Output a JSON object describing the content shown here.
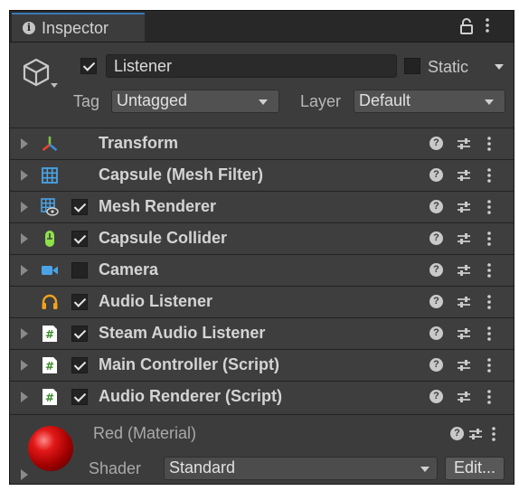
{
  "window": {
    "tab_title": "Inspector",
    "tab_icon": "info-icon"
  },
  "header": {
    "active": true,
    "name": "Listener",
    "static_label": "Static",
    "static_checked": false,
    "tag_label": "Tag",
    "tag_value": "Untagged",
    "layer_label": "Layer",
    "layer_value": "Default"
  },
  "components": [
    {
      "label": "Transform",
      "icon": "transform-icon",
      "has_checkbox": false
    },
    {
      "label": "Capsule (Mesh Filter)",
      "icon": "mesh-filter-icon",
      "has_checkbox": false
    },
    {
      "label": "Mesh Renderer",
      "icon": "mesh-renderer-icon",
      "has_checkbox": true,
      "checked": true
    },
    {
      "label": "Capsule Collider",
      "icon": "capsule-collider-icon",
      "has_checkbox": true,
      "checked": true
    },
    {
      "label": "Camera",
      "icon": "camera-icon",
      "has_checkbox": true,
      "checked": false
    },
    {
      "label": "Audio Listener",
      "icon": "audio-listener-icon",
      "has_checkbox": true,
      "checked": true
    },
    {
      "label": "Steam Audio Listener",
      "icon": "script-icon",
      "has_checkbox": true,
      "checked": true
    },
    {
      "label": "Main Controller (Script)",
      "icon": "script-icon",
      "has_checkbox": true,
      "checked": true
    },
    {
      "label": "Audio Renderer (Script)",
      "icon": "script-icon",
      "has_checkbox": true,
      "checked": true
    }
  ],
  "material": {
    "name": "Red (Material)",
    "shader_label": "Shader",
    "shader_value": "Standard",
    "edit_label": "Edit..."
  },
  "colors": {
    "tab_accent": "#3a79bb",
    "panel_bg": "#3c3c3c",
    "row_bg": "#3e3e3e",
    "material_red": "#e21818"
  }
}
